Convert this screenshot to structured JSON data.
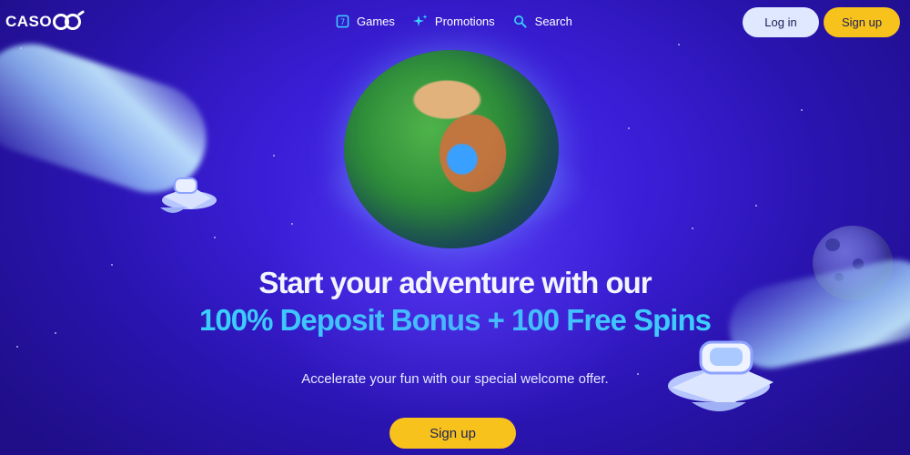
{
  "brand": {
    "logo_text": "CASO"
  },
  "nav": {
    "items": [
      {
        "label": "Games",
        "icon": "games-icon"
      },
      {
        "label": "Promotions",
        "icon": "sparkle-icon"
      },
      {
        "label": "Search",
        "icon": "search-icon"
      }
    ]
  },
  "auth": {
    "login_label": "Log in",
    "signup_label": "Sign up"
  },
  "hero": {
    "title": "Start your adventure with our",
    "highlight": "100% Deposit Bonus + 100 Free Spins",
    "description": "Accelerate your fun with our special welcome offer.",
    "cta_label": "Sign up"
  },
  "colors": {
    "accent": "#f7c21c",
    "login_bg": "#dfe8ff",
    "highlight_text": "#2ee3ff",
    "background": "#3a1ed6"
  }
}
